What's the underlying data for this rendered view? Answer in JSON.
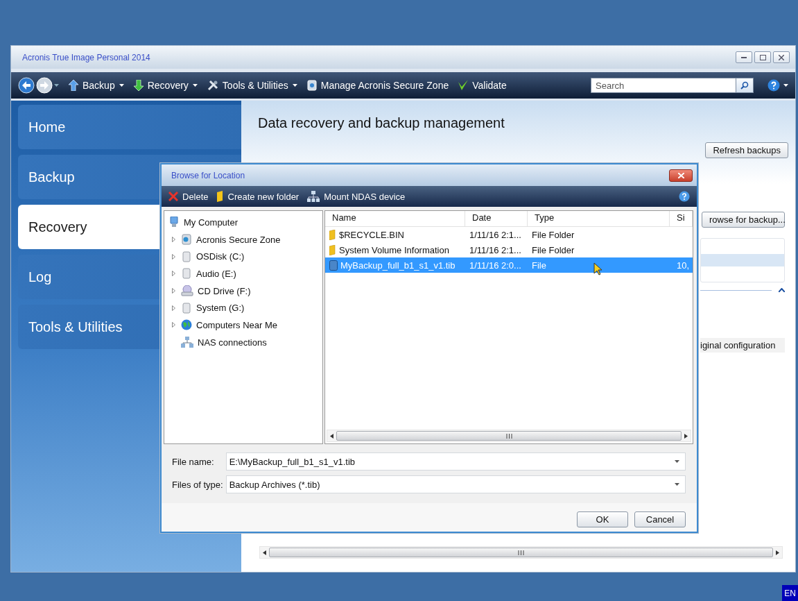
{
  "window": {
    "title": "Acronis True Image Personal 2014"
  },
  "toolbar": {
    "items": [
      {
        "label": "Backup",
        "kind": "backup",
        "has_menu": true
      },
      {
        "label": "Recovery",
        "kind": "recovery",
        "has_menu": true
      },
      {
        "label": "Tools & Utilities",
        "kind": "tools",
        "has_menu": true
      },
      {
        "label": "Manage Acronis Secure Zone",
        "kind": "secure-zone",
        "has_menu": false
      },
      {
        "label": "Validate",
        "kind": "validate",
        "has_menu": false
      }
    ],
    "search": {
      "placeholder": "Search"
    }
  },
  "sidebar": {
    "items": [
      {
        "label": "Home",
        "selected": false
      },
      {
        "label": "Backup",
        "selected": false
      },
      {
        "label": "Recovery",
        "selected": true
      },
      {
        "label": "Log",
        "selected": false
      },
      {
        "label": "Tools & Utilities",
        "selected": false
      }
    ]
  },
  "content": {
    "heading": "Data recovery and backup management",
    "refresh_button": "Refresh backups",
    "browse_button": "rowse for backup...",
    "config_text": "iginal configuration"
  },
  "dialog": {
    "title": "Browse for Location",
    "toolbar": [
      {
        "label": "Delete",
        "kind": "delete"
      },
      {
        "label": "Create new folder",
        "kind": "folder"
      },
      {
        "label": "Mount NDAS device",
        "kind": "network"
      }
    ],
    "tree": {
      "label": "My Computer",
      "kind": "computer",
      "children": [
        {
          "label": "Acronis Secure Zone",
          "kind": "secure-zone",
          "has_children": true
        },
        {
          "label": "OSDisk (C:)",
          "kind": "disk",
          "has_children": true
        },
        {
          "label": "Audio (E:)",
          "kind": "disk",
          "has_children": true
        },
        {
          "label": "CD Drive (F:)",
          "kind": "cd",
          "has_children": true
        },
        {
          "label": "System (G:)",
          "kind": "disk",
          "has_children": true
        },
        {
          "label": "Computers Near Me",
          "kind": "globe",
          "has_children": true
        },
        {
          "label": "NAS connections",
          "kind": "nas",
          "has_children": false
        }
      ]
    },
    "columns": [
      "Name",
      "Date",
      "Type",
      "Si"
    ],
    "files": [
      {
        "name": "$RECYCLE.BIN",
        "date": "1/11/16 2:1...",
        "type": "File Folder",
        "kind": "folder",
        "selected": false
      },
      {
        "name": "System Volume Information",
        "date": "1/11/16 2:1...",
        "type": "File Folder",
        "kind": "folder",
        "selected": false
      },
      {
        "name": "MyBackup_full_b1_s1_v1.tib",
        "date": "1/11/16 2:0...",
        "type": "File",
        "size": "10,",
        "kind": "file",
        "selected": true
      }
    ],
    "file_name_label": "File name:",
    "file_name": "E:\\MyBackup_full_b1_s1_v1.tib",
    "file_type_label": "Files of type:",
    "file_type": "Backup Archives (*.tib)",
    "buttons": [
      "OK",
      "Cancel"
    ]
  },
  "language": "EN"
}
